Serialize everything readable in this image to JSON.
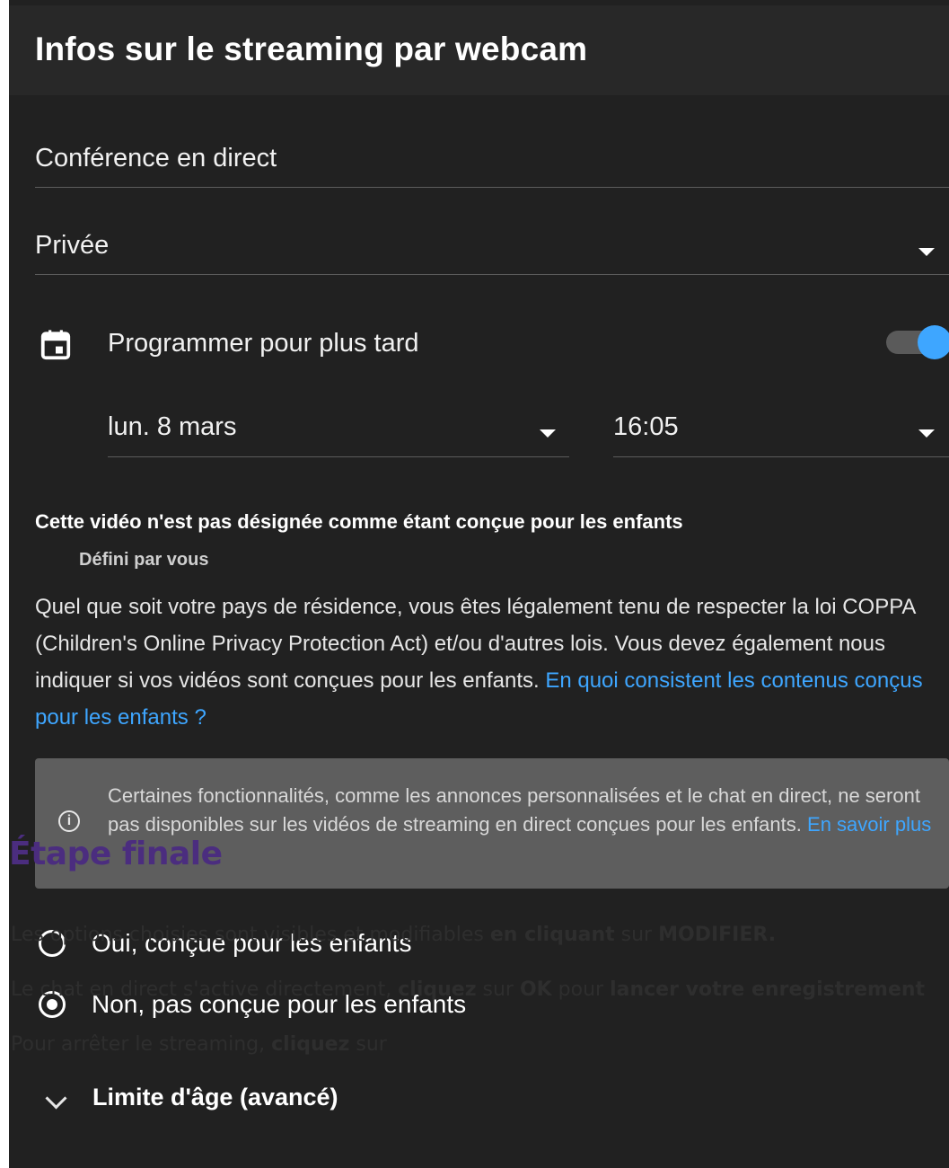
{
  "header": {
    "title": "Infos sur le streaming par webcam"
  },
  "title_field": {
    "value": "Conférence en direct"
  },
  "visibility": {
    "value": "Privée"
  },
  "schedule": {
    "icon": "calendar-icon",
    "label": "Programmer pour plus tard",
    "enabled": true,
    "date": "lun. 8 mars",
    "time": "16:05"
  },
  "audience": {
    "title": "Cette vidéo n'est pas désignée comme étant conçue pour les enfants",
    "subtitle": "Défini par vous",
    "body": "Quel que soit votre pays de résidence, vous êtes légalement tenu de respecter la loi COPPA (Children's Online Privacy Protection Act) et/ou d'autres lois. Vous devez également nous indiquer si vos vidéos sont conçues pour les enfants.",
    "link": "En quoi consistent les contenus conçus pour les enfants ?",
    "info_icon": "info-icon",
    "info_text": "Certaines fonctionnalités, comme les annonces personnalisées et le chat en direct, ne seront pas disponibles sur les vidéos de streaming en direct conçues pour les enfants.",
    "info_link": "En savoir plus",
    "option_yes": "Oui, conçue pour les enfants",
    "option_no": "Non, pas conçue pour les enfants",
    "selected": "no",
    "age_limit": "Limite d'âge (avancé)"
  },
  "overlay": {
    "title": "Étape finale",
    "line1_a": "Les options choisies sont visibles et modifiables ",
    "line1_b": "en cliquant",
    "line1_c": " sur ",
    "line1_d": "MODIFIER.",
    "line2_a": "Le chat en direct s'active directement, ",
    "line2_b": "cliquez",
    "line2_c": " sur ",
    "line2_d": "OK",
    "line2_e": " pour ",
    "line2_f": "lancer votre enregistrement",
    "line3_a": "Pour arrêter le streaming, ",
    "line3_b": "cliquez",
    "line3_c": " sur"
  },
  "colors": {
    "accent": "#3ea6ff",
    "panel": "#212121",
    "overlay_title": "#4b2d7f"
  }
}
